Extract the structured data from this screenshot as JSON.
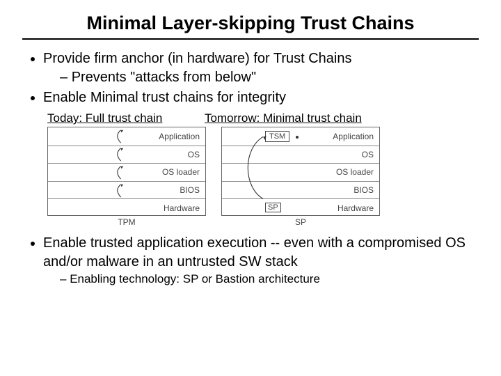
{
  "title": "Minimal Layer-skipping Trust Chains",
  "bullets": {
    "b1": "Provide firm anchor (in hardware) for Trust Chains",
    "b1_sub": "Prevents \"attacks from below\"",
    "b2": "Enable Minimal trust chains for integrity",
    "b3": "Enable trusted application execution -- even with a compromised OS and/or malware in an untrusted SW stack",
    "b3_sub": "Enabling technology: SP or Bastion architecture"
  },
  "figure": {
    "left_caption": "Today: Full trust chain",
    "right_caption": "Tomorrow: Minimal trust chain",
    "layers": [
      "Application",
      "OS",
      "OS loader",
      "BIOS",
      "Hardware"
    ],
    "left_label": "TPM",
    "right_label": "SP",
    "tsm_label": "TSM",
    "sp_box_label": "SP"
  }
}
